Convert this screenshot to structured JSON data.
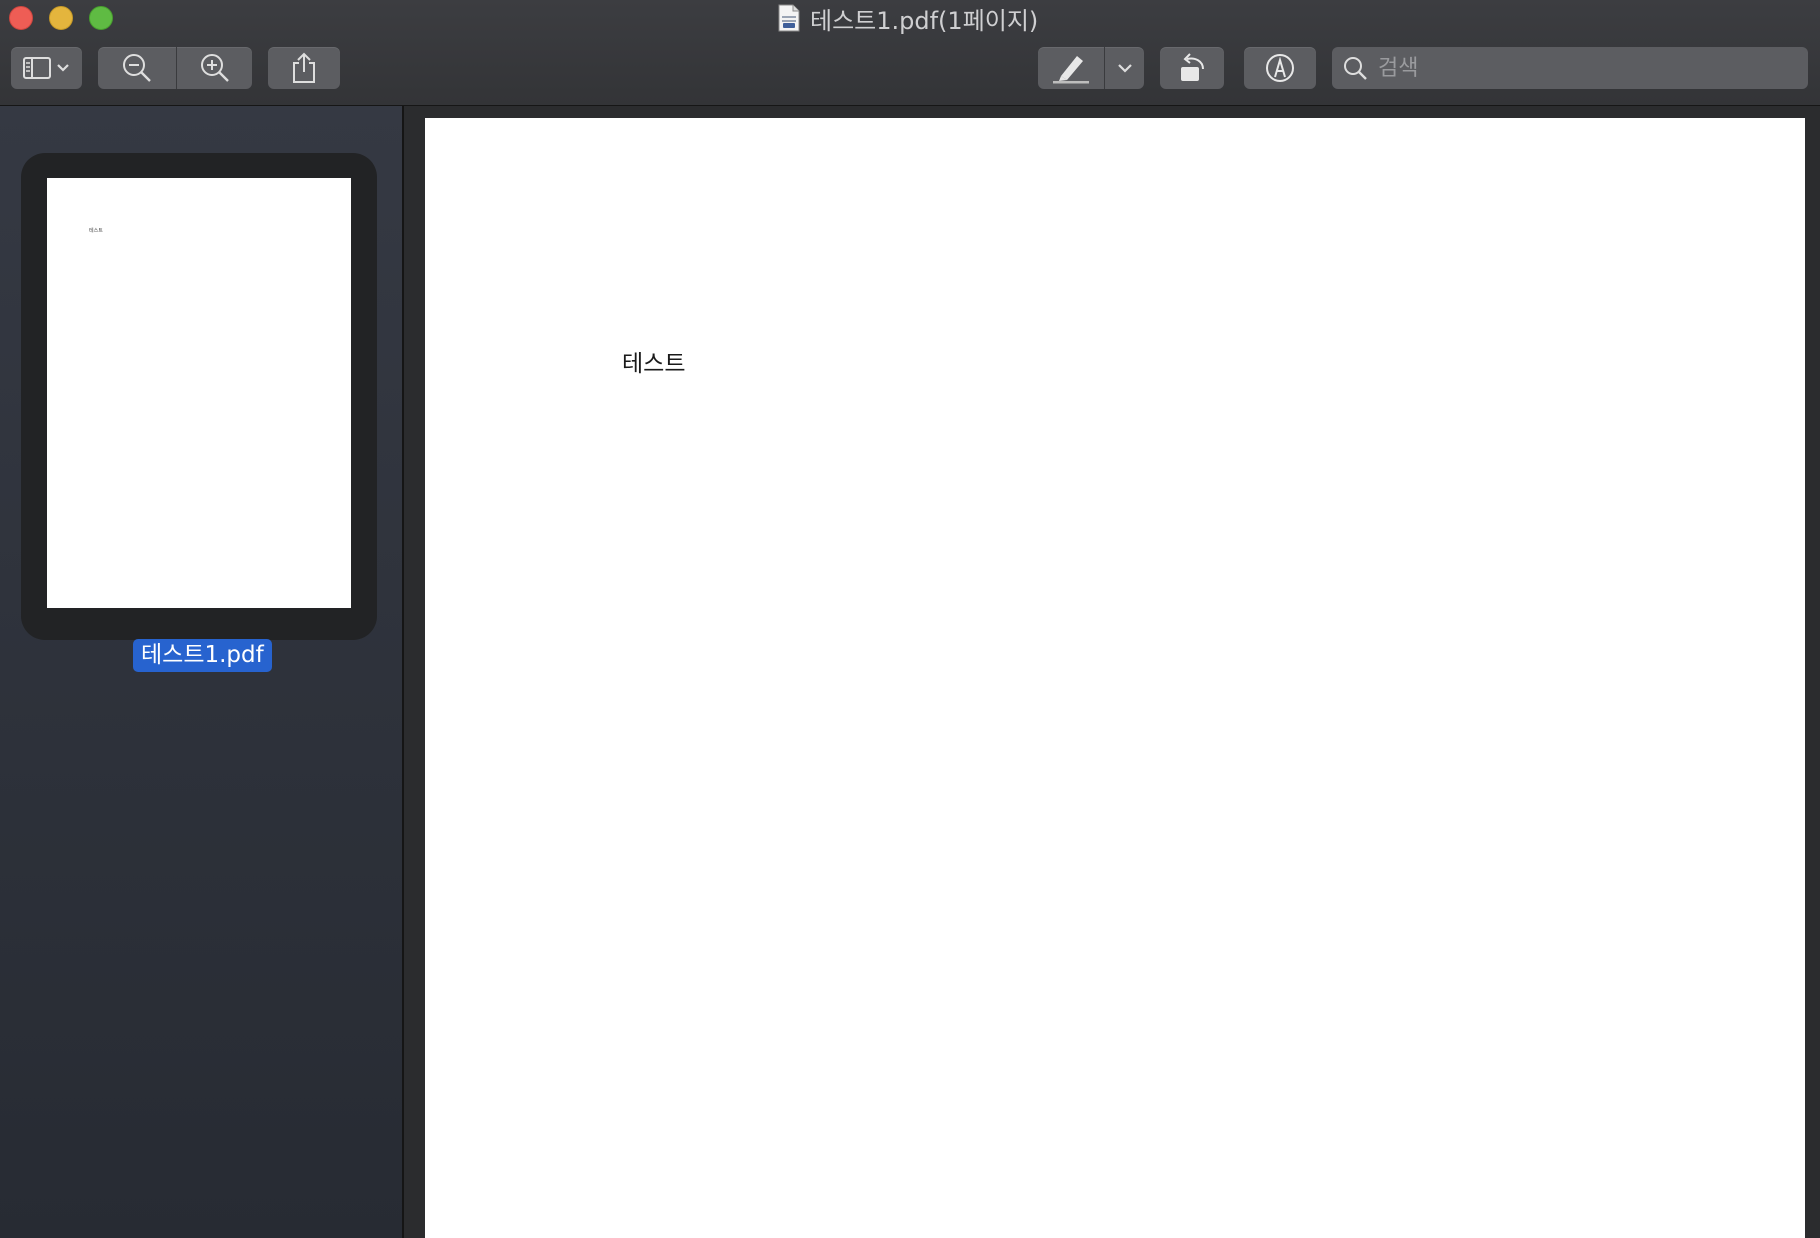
{
  "window": {
    "title": "테스트1.pdf(1페이지)",
    "traffic_lights": {
      "close_color": "#ee5d55",
      "minimize_color": "#e4b53d",
      "maximize_color": "#5fbb43"
    }
  },
  "toolbar": {
    "sidebar_toggle_icon": "sidebar-icon",
    "zoom_out_icon": "zoom-out-icon",
    "zoom_in_icon": "zoom-in-icon",
    "share_icon": "share-icon",
    "highlight_icon": "highlighter-icon",
    "rotate_icon": "rotate-left-icon",
    "markup_icon": "markup-pen-icon",
    "search": {
      "placeholder": "검색",
      "value": ""
    }
  },
  "sidebar": {
    "thumbnail": {
      "page_text": "테스트",
      "label": "테스트1.pdf"
    },
    "selection_color": "#2763cf"
  },
  "document": {
    "page_text": "테스트"
  }
}
